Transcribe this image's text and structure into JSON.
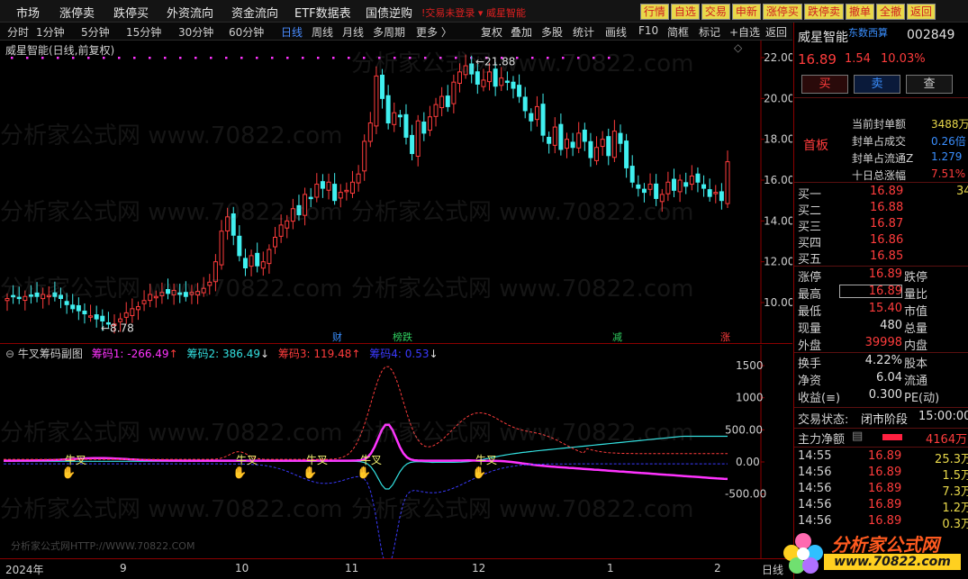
{
  "menu": {
    "items": [
      "市场",
      "涨停卖",
      "跌停买",
      "外资流向",
      "资金流向",
      "ETF数据表",
      "国债逆购"
    ],
    "warning": "!交易未登录",
    "stock_alert": "威星智能",
    "quick_buttons": [
      "行情",
      "自选",
      "交易",
      "申新",
      "涨停买",
      "跌停卖",
      "撤单",
      "全撤",
      "返回"
    ]
  },
  "toolbar": {
    "periods": [
      "分时",
      "1分钟",
      "5分钟",
      "15分钟",
      "30分钟",
      "60分钟",
      "日线",
      "周线",
      "月线",
      "多周期",
      "更多 〉"
    ],
    "active_period": "日线",
    "buttons": [
      "复权",
      "叠加",
      "多股",
      "统计",
      "画线",
      "F10",
      "简框",
      "标记",
      "+自选",
      "返回"
    ]
  },
  "chart": {
    "title": "威星智能(日线,前复权)",
    "price_ticks": [
      "22.00",
      "20.00",
      "18.00",
      "16.00",
      "14.00",
      "12.00",
      "10.00"
    ],
    "high_label": "21.88",
    "low_label": "8.78",
    "event_markers": [
      "财",
      "榜跌",
      "减",
      "涨"
    ]
  },
  "sub_chart": {
    "title": "牛叉筹码副图",
    "series": [
      {
        "name": "筹码1:",
        "value": "-266.49",
        "arrow": "↑",
        "color": "#ff33ff"
      },
      {
        "name": "筹码2:",
        "value": "386.49",
        "arrow": "↓",
        "color": "#33e0e0"
      },
      {
        "name": "筹码3:",
        "value": "119.48",
        "arrow": "↑",
        "color": "#ff3c3c"
      },
      {
        "name": "筹码4:",
        "value": "0.53",
        "arrow": "↓",
        "color": "#3a3aff"
      }
    ],
    "value_ticks": [
      "1500",
      "1000",
      "500.00",
      "0.00",
      "-500.00"
    ],
    "signal_label": "牛叉"
  },
  "xaxis": {
    "labels": [
      "2024年",
      "9",
      "10",
      "11",
      "12",
      "1",
      "2"
    ],
    "corner": "日线"
  },
  "quote": {
    "name": "威星智能",
    "tag": "东数西算",
    "code": "002849",
    "price": "16.89",
    "change": "1.54",
    "change_pct": "10.03%",
    "buttons": [
      "买",
      "卖",
      "查"
    ],
    "board": "首板",
    "seal": [
      {
        "label": "当前封单额",
        "value": "3488万"
      },
      {
        "label": "封单占成交",
        "value": "0.26倍"
      },
      {
        "label": "封单占流通Z",
        "value": "1.279"
      },
      {
        "label": "十日总涨幅",
        "value": "7.51%"
      }
    ],
    "orderbook": [
      {
        "label": "买一",
        "price": "16.89",
        "vol": "34"
      },
      {
        "label": "买二",
        "price": "16.88",
        "vol": ""
      },
      {
        "label": "买三",
        "price": "16.87",
        "vol": ""
      },
      {
        "label": "买四",
        "price": "16.86",
        "vol": ""
      },
      {
        "label": "买五",
        "price": "16.85",
        "vol": ""
      }
    ],
    "stats": [
      {
        "l1": "涨停",
        "v1": "16.89",
        "l2": "跌停"
      },
      {
        "l1": "最高",
        "v1": "16.89",
        "l2": "量比"
      },
      {
        "l1": "最低",
        "v1": "15.40",
        "l2": "市值"
      },
      {
        "l1": "现量",
        "v1": "480",
        "l2": "总量"
      },
      {
        "l1": "外盘",
        "v1": "39998",
        "l2": "内盘"
      },
      {
        "l1": "换手",
        "v1": "4.22%",
        "l2": "股本"
      },
      {
        "l1": "净资",
        "v1": "6.04",
        "l2": "流通"
      },
      {
        "l1": "收益(≡)",
        "v1": "0.300",
        "l2": "PE(动)"
      }
    ],
    "trade_status_label": "交易状态:",
    "trade_status": "闭市阶段",
    "trade_time": "15:00:00",
    "main_flow_label": "主力净额",
    "main_flow_value": "4164万",
    "ticks": [
      {
        "t": "14:55",
        "p": "16.89",
        "v": "25.3万"
      },
      {
        "t": "14:56",
        "p": "16.89",
        "v": "1.5万"
      },
      {
        "t": "14:56",
        "p": "16.89",
        "v": "7.3万"
      },
      {
        "t": "14:56",
        "p": "16.89",
        "v": "1.2万"
      },
      {
        "t": "14:56",
        "p": "16.89",
        "v": "0.3万"
      }
    ]
  },
  "watermark": {
    "text": "分析家公式网 www.70822.com",
    "small": "分析家公式网HTTP://WWW.70822.COM"
  },
  "logo": {
    "text": "分析家公式网",
    "url": "www.70822.com"
  }
}
